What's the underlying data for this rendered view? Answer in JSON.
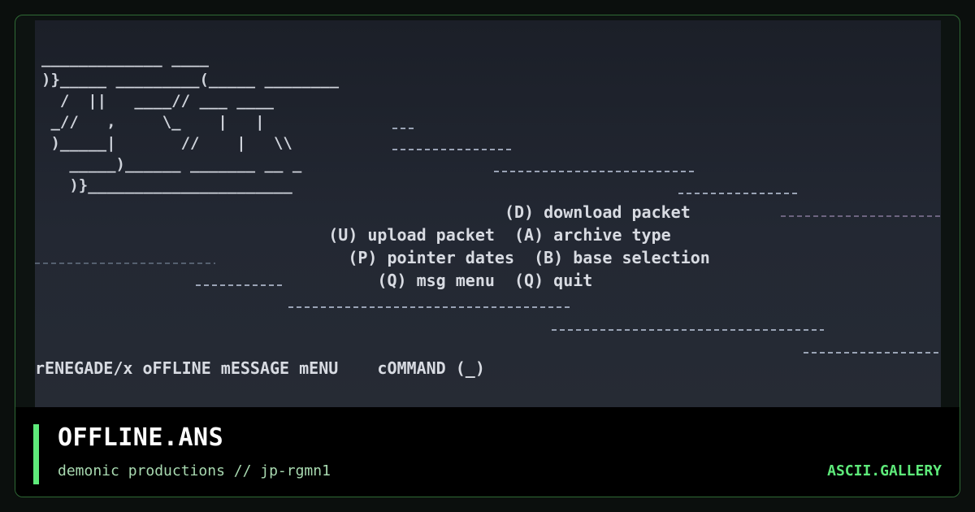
{
  "artwork": {
    "logo_ascii": "_____________ ____\n)}_____ _________(_____ ________\n  /  ||   ____// ___ ____\n _//   ,     \\_    |   |\n )_____|       //    |   \\\\\n   _____)______ _______ __ _\n   )}______________________",
    "menu_lines": [
      "                                                (D) download packet",
      "                              (U) upload packet  (A) archive type",
      "                                (P) pointer dates  (B) base selection",
      "                                   (Q) msg menu  (Q) quit"
    ],
    "status_line": "rENEGADE/x oFFLINE mESSAGE mENU    cOMMAND (_)"
  },
  "caption": {
    "title": "OFFLINE.ANS",
    "subtitle": "demonic productions // jp-rgmn1",
    "brand": "ASCII.GALLERY"
  },
  "colors": {
    "accent": "#5eea7a",
    "background": "#0b0f0d",
    "frame_border": "#2f6a35"
  }
}
